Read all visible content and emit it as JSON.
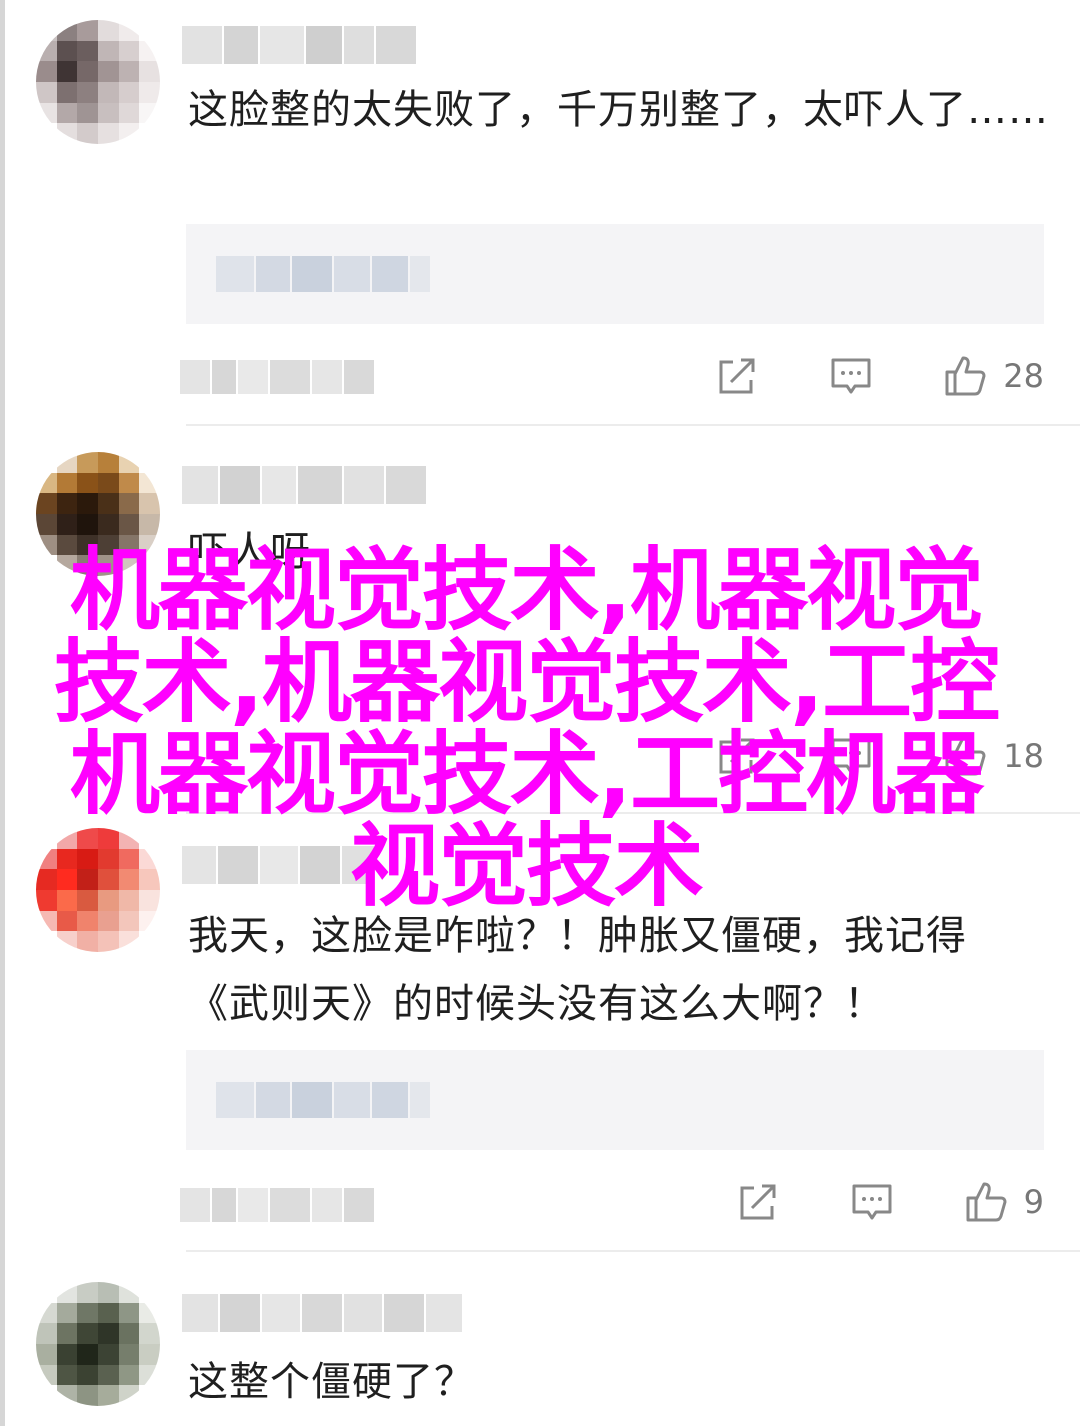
{
  "comments": [
    {
      "text": "这脸整的太失败了，千万别整了，太吓人了……",
      "likes": "28",
      "avatar_colors": [
        "#c9c2c2",
        "#8b8080",
        "#a89b9b",
        "#e2dcdc",
        "#f0ebeb",
        "#ffffff",
        "#b9afaf",
        "#5c5050",
        "#6b5e5e",
        "#c0b6b6",
        "#d7cfcf",
        "#f6f2f2",
        "#9a8c8c",
        "#3f3434",
        "#766868",
        "#a19494",
        "#bdb2b2",
        "#e7e1e1",
        "#cfc6c6",
        "#7d7070",
        "#8d8080",
        "#c2b8b8",
        "#d6cdcd",
        "#efeaea",
        "#e8e3e3",
        "#b3a8a8",
        "#9f9494",
        "#c8bfbf",
        "#dfd8d8",
        "#f8f6f6",
        "#ffffff",
        "#e4dede",
        "#d3cbcb",
        "#e6e0e0",
        "#f3efef",
        "#ffffff"
      ]
    },
    {
      "text": "吓人呀",
      "likes": "18",
      "avatar_colors": [
        "#ffffff",
        "#e6d6c2",
        "#c79a5a",
        "#b7803a",
        "#e8d2b1",
        "#ffffff",
        "#d9b783",
        "#b37a36",
        "#8a5218",
        "#7a4a1a",
        "#c08a4a",
        "#f3e6d4",
        "#6b4420",
        "#3d2410",
        "#2b190b",
        "#4a3018",
        "#8a6a4a",
        "#d8c4ad",
        "#5b4636",
        "#2f2018",
        "#1f140c",
        "#3a2a1e",
        "#6a5646",
        "#c7b8a8",
        "#9e8f83",
        "#5a4a3e",
        "#3e3128",
        "#4d3f35",
        "#857568",
        "#d9cfc6",
        "#ffffff",
        "#b5a89e",
        "#8a7d73",
        "#a09389",
        "#d0c6be",
        "#ffffff"
      ]
    },
    {
      "text_line1": "我天，这脸是咋啦？！肿胀又僵硬，我记得",
      "text_line2": "《武则天》的时候头没有这么大啊？！",
      "likes": "9",
      "avatar_colors": [
        "#ffffff",
        "#f2a8a8",
        "#ef4a4a",
        "#ee3b3b",
        "#f3b3b3",
        "#ffffff",
        "#f08080",
        "#e8281f",
        "#d81b14",
        "#e23a2f",
        "#f06a5f",
        "#fbd9d6",
        "#e62a22",
        "#ff2b1f",
        "#c22018",
        "#e0503c",
        "#f28a72",
        "#f7c7bc",
        "#ef3a30",
        "#fb6a4a",
        "#d95a40",
        "#e89a80",
        "#f0b8a8",
        "#f9e3de",
        "#f6b9b3",
        "#e85a48",
        "#f0836c",
        "#e9a090",
        "#f3c6bb",
        "#fdf1ef",
        "#ffffff",
        "#f7d0cb",
        "#f1b0a5",
        "#f4c2b8",
        "#fae0db",
        "#ffffff"
      ]
    },
    {
      "text": "这整个僵硬了？",
      "avatar_colors": [
        "#ffffff",
        "#e2e4e0",
        "#c8ccc4",
        "#b8beb4",
        "#dfe2dc",
        "#ffffff",
        "#d6d9d2",
        "#a4aa9c",
        "#6f7766",
        "#59614f",
        "#8e9686",
        "#e9ebe6",
        "#bfc4b9",
        "#6d7462",
        "#3f4636",
        "#2f3528",
        "#6a7260",
        "#d2d6cd",
        "#a9afa0",
        "#3a4132",
        "#20261a",
        "#3c4334",
        "#767e6c",
        "#c9cdc2",
        "#c6cabf",
        "#4e5544",
        "#3b4232",
        "#5a6150",
        "#8f9785",
        "#dcdfd8",
        "#ffffff",
        "#aeb3a6",
        "#8d9483",
        "#a6ac9b",
        "#cfd3c9",
        "#ffffff"
      ]
    }
  ],
  "watermark": "机器视觉技术,机器视觉技术,机器视觉技术,工控机器视觉技术,工控机器视觉技术"
}
